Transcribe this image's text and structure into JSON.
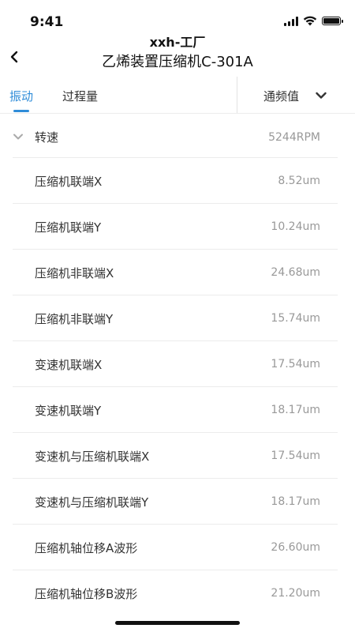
{
  "status_bar": {
    "time": "9:41"
  },
  "header": {
    "factory": "xxh-工厂",
    "device": "乙烯装置压缩机C-301A"
  },
  "tabs": [
    {
      "label": "振动",
      "active": true
    },
    {
      "label": "过程量",
      "active": false
    }
  ],
  "filter": {
    "selected": "通频值"
  },
  "group": {
    "title": "转速",
    "value": "5244RPM"
  },
  "rows": [
    {
      "label": "压缩机联端X",
      "value": "8.52um"
    },
    {
      "label": "压缩机联端Y",
      "value": "10.24um"
    },
    {
      "label": "压缩机非联端X",
      "value": "24.68um"
    },
    {
      "label": "压缩机非联端Y",
      "value": "15.74um"
    },
    {
      "label": "变速机联端X",
      "value": "17.54um"
    },
    {
      "label": "变速机联端Y",
      "value": "18.17um"
    },
    {
      "label": "变速机与压缩机联端X",
      "value": "17.54um"
    },
    {
      "label": "变速机与压缩机联端Y",
      "value": "18.17um"
    },
    {
      "label": "压缩机轴位移A波形",
      "value": "26.60um"
    },
    {
      "label": "压缩机轴位移B波形",
      "value": "21.20um"
    }
  ],
  "colors": {
    "accent": "#2f8cd8",
    "muted": "#999999"
  }
}
